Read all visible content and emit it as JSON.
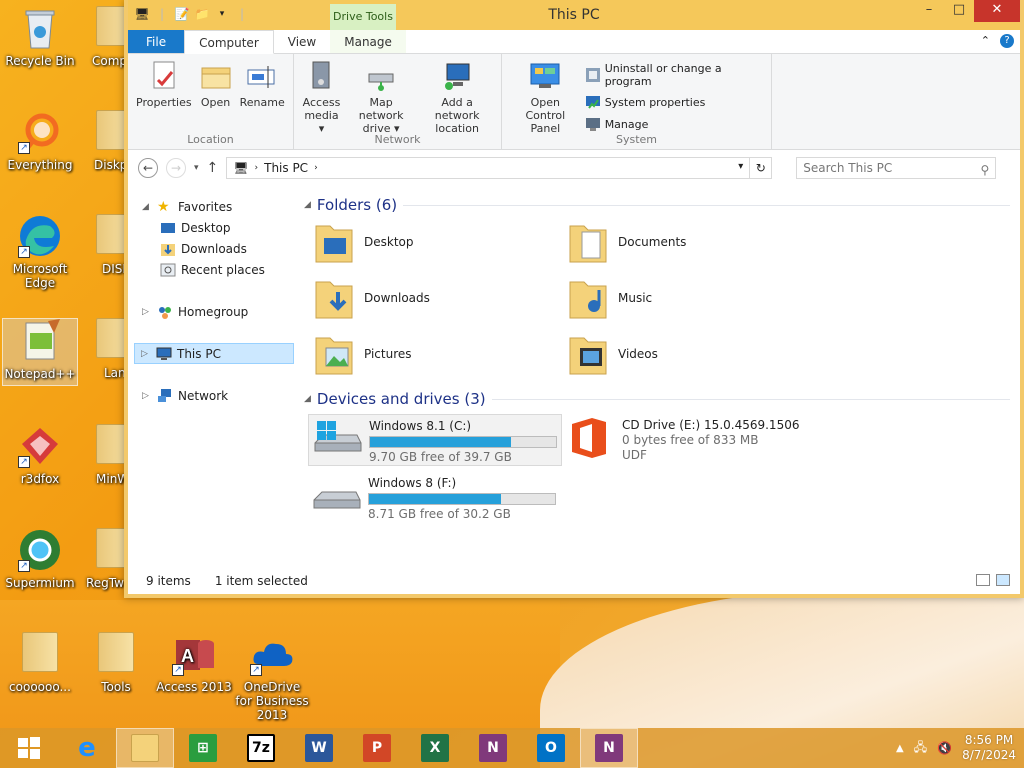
{
  "desktop": {
    "icons": [
      {
        "label": "Recycle Bin"
      },
      {
        "label": "Everything"
      },
      {
        "label": "Microsoft Edge"
      },
      {
        "label": "Notepad++"
      },
      {
        "label": "r3dfox"
      },
      {
        "label": "Supermium"
      },
      {
        "label": "coooooo..."
      },
      {
        "label": "Tools"
      },
      {
        "label": "Access 2013"
      },
      {
        "label": "OneDrive for Business 2013"
      },
      {
        "label": "Comp"
      },
      {
        "label": "Diskp"
      },
      {
        "label": "DISM"
      },
      {
        "label": "Lan"
      },
      {
        "label": "MinW"
      },
      {
        "label": "RegTw"
      }
    ]
  },
  "window": {
    "title": "This PC",
    "context_tab": "Drive Tools",
    "tabs": [
      "File",
      "Computer",
      "View",
      "Manage"
    ],
    "ribbon": {
      "location": {
        "label": "Location",
        "buttons": [
          "Properties",
          "Open",
          "Rename"
        ]
      },
      "network": {
        "label": "Network",
        "buttons": [
          {
            "line1": "Access",
            "line2": "media ▾"
          },
          {
            "line1": "Map network",
            "line2": "drive ▾"
          },
          {
            "line1": "Add a network",
            "line2": "location"
          }
        ]
      },
      "system": {
        "label": "System",
        "big": {
          "line1": "Open Control",
          "line2": "Panel"
        },
        "small": [
          "Uninstall or change a program",
          "System properties",
          "Manage"
        ]
      }
    },
    "address": {
      "path": "This PC"
    },
    "search": {
      "placeholder": "Search This PC"
    },
    "nav": {
      "favorites": "Favorites",
      "fav_items": [
        "Desktop",
        "Downloads",
        "Recent places"
      ],
      "homegroup": "Homegroup",
      "thispc": "This PC",
      "network": "Network"
    },
    "folders_header": "Folders (6)",
    "folders": [
      "Desktop",
      "Documents",
      "Downloads",
      "Music",
      "Pictures",
      "Videos"
    ],
    "drives_header": "Devices and drives (3)",
    "drives": [
      {
        "name": "Windows 8.1 (C:)",
        "free": "9.70 GB free of 39.7 GB",
        "used_fraction": 0.76
      },
      {
        "name": "CD Drive (E:) 15.0.4569.1506",
        "free": "0 bytes free of 833 MB",
        "fs": "UDF"
      },
      {
        "name": "Windows 8 (F:)",
        "free": "8.71 GB free of 30.2 GB",
        "used_fraction": 0.71
      }
    ],
    "status": {
      "items": "9 items",
      "selected": "1 item selected"
    }
  },
  "taskbar": {
    "time": "8:56 PM",
    "date": "8/7/2024",
    "apps": [
      "Start",
      "Internet Explorer",
      "File Explorer",
      "Store",
      "7-Zip",
      "Word",
      "PowerPoint",
      "Excel",
      "OneNote",
      "Outlook",
      "OneNote Clipper"
    ],
    "colors": {
      "word": "#2b579a",
      "ppt": "#d24726",
      "excel": "#217346",
      "onenote": "#80397b",
      "outlook": "#0072c6"
    }
  }
}
